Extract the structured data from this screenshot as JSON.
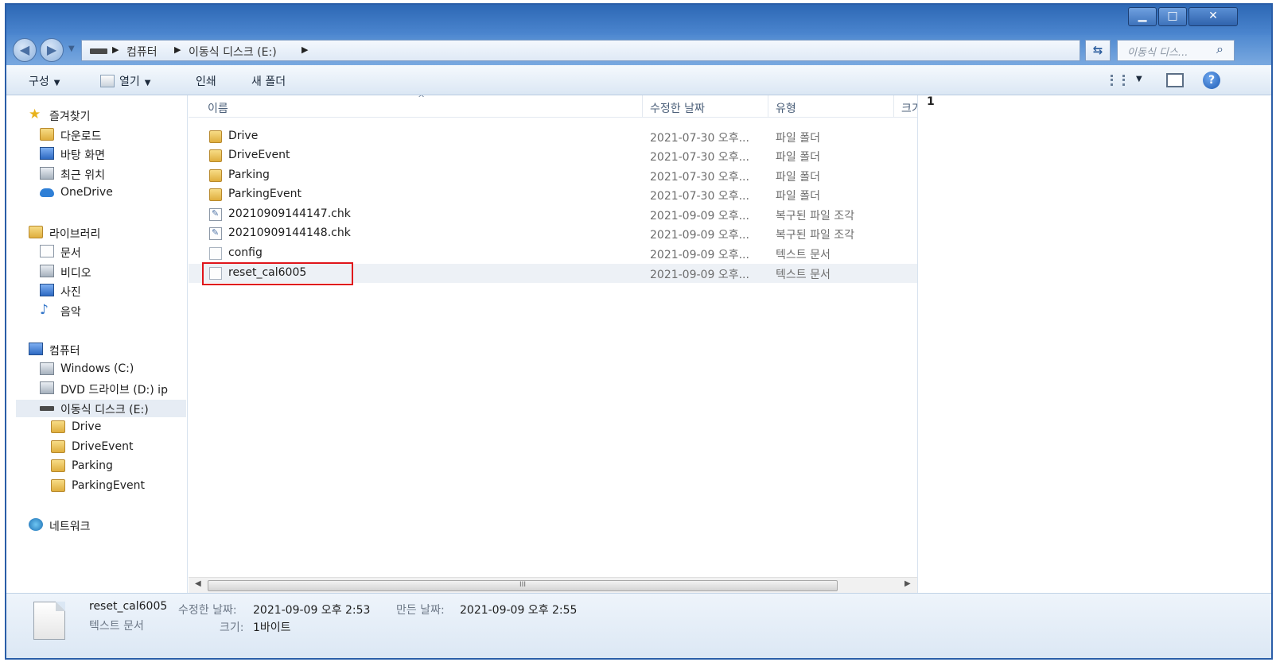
{
  "window": {
    "controls": [
      "minimize",
      "maximize",
      "close"
    ]
  },
  "address": {
    "crumbs": [
      "컴퓨터",
      "이동식 디스크 (E:)"
    ],
    "search_placeholder": "이동식 디스..."
  },
  "toolbar": {
    "organize": "구성",
    "open": "열기",
    "print": "인쇄",
    "new_folder": "새 폴더"
  },
  "nav": {
    "favorites": "즐겨찾기",
    "downloads": "다운로드",
    "desktop": "바탕 화면",
    "recent": "최근 위치",
    "onedrive": "OneDrive",
    "libraries": "라이브러리",
    "documents": "문서",
    "videos": "비디오",
    "pictures": "사진",
    "music": "음악",
    "computer": "컴퓨터",
    "drive_c": "Windows (C:)",
    "drive_d": "DVD 드라이브 (D:) ip",
    "drive_e": "이동식 디스크 (E:)",
    "sub_drive": "Drive",
    "sub_driveevent": "DriveEvent",
    "sub_parking": "Parking",
    "sub_parkingevent": "ParkingEvent",
    "network": "네트워크"
  },
  "columns": {
    "name": "이름",
    "modified": "수정한 날짜",
    "type": "유형",
    "size": "크기"
  },
  "files": [
    {
      "name": "Drive",
      "date": "2021-07-30 오후...",
      "type": "파일 폴더",
      "kind": "folder"
    },
    {
      "name": "DriveEvent",
      "date": "2021-07-30 오후...",
      "type": "파일 폴더",
      "kind": "folder"
    },
    {
      "name": "Parking",
      "date": "2021-07-30 오후...",
      "type": "파일 폴더",
      "kind": "folder"
    },
    {
      "name": "ParkingEvent",
      "date": "2021-07-30 오후...",
      "type": "파일 폴더",
      "kind": "folder"
    },
    {
      "name": "20210909144147.chk",
      "date": "2021-09-09 오후...",
      "type": "복구된 파일 조각",
      "kind": "chk"
    },
    {
      "name": "20210909144148.chk",
      "date": "2021-09-09 오후...",
      "type": "복구된 파일 조각",
      "kind": "chk"
    },
    {
      "name": "config",
      "date": "2021-09-09 오후...",
      "type": "텍스트 문서",
      "kind": "doc"
    },
    {
      "name": "reset_cal6005",
      "date": "2021-09-09 오후...",
      "type": "텍스트 문서",
      "kind": "doc"
    }
  ],
  "scroll": {
    "thumb_grip": "III"
  },
  "preview": {
    "content": "1"
  },
  "details": {
    "filename": "reset_cal6005",
    "filetype": "텍스트 문서",
    "modified_label": "수정한 날짜:",
    "modified_value": "2021-09-09 오후 2:53",
    "created_label": "만든 날짜:",
    "created_value": "2021-09-09 오후 2:55",
    "size_label": "크기:",
    "size_value": "1바이트"
  },
  "colors": {
    "highlight": "#e0151b",
    "titlebar": "#2d68b5"
  }
}
